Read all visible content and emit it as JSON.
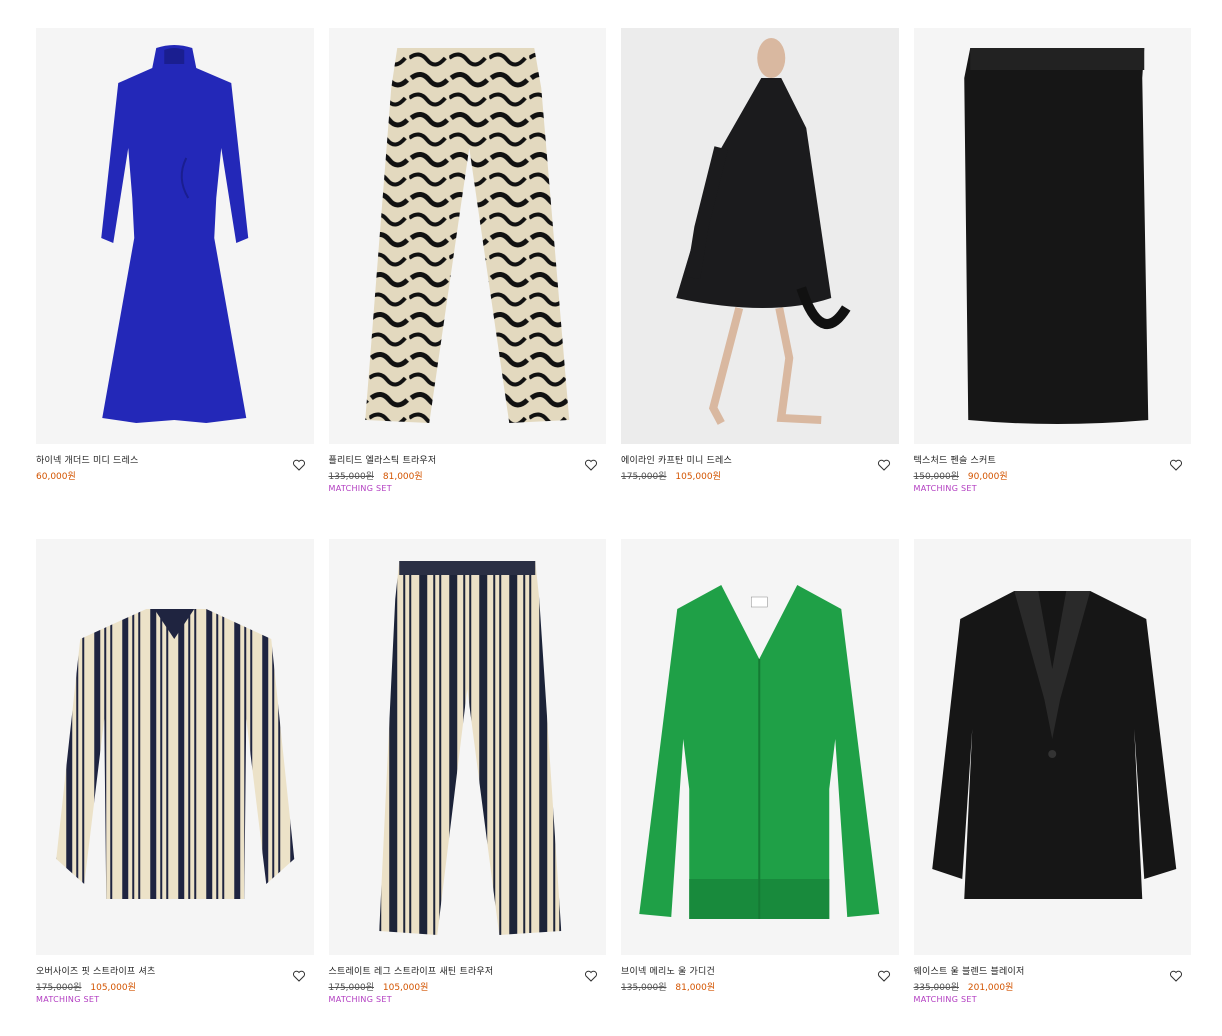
{
  "products": [
    {
      "name": "하이넥 개더드 미디 드레스",
      "old_price": "",
      "price": "60,000원",
      "badge": "",
      "icon": "heart-icon"
    },
    {
      "name": "플리티드 엘라스틱 트라우저",
      "old_price": "135,000원",
      "price": "81,000원",
      "badge": "MATCHING SET",
      "icon": "heart-icon"
    },
    {
      "name": "에이라인 카프탄 미니 드레스",
      "old_price": "175,000원",
      "price": "105,000원",
      "badge": "",
      "icon": "heart-icon"
    },
    {
      "name": "텍스처드 펜슬 스커트",
      "old_price": "150,000원",
      "price": "90,000원",
      "badge": "MATCHING SET",
      "icon": "heart-icon"
    },
    {
      "name": "오버사이즈 핏 스트라이프 셔츠",
      "old_price": "175,000원",
      "price": "105,000원",
      "badge": "MATCHING SET",
      "icon": "heart-icon"
    },
    {
      "name": "스트레이트 레그 스트라이프 새틴 트라우저",
      "old_price": "175,000원",
      "price": "105,000원",
      "badge": "MATCHING SET",
      "icon": "heart-icon"
    },
    {
      "name": "브이넥 메리노 울 가디건",
      "old_price": "135,000원",
      "price": "81,000원",
      "badge": "",
      "icon": "heart-icon"
    },
    {
      "name": "웨이스트 울 블렌드 블레이저",
      "old_price": "335,000원",
      "price": "201,000원",
      "badge": "MATCHING SET",
      "icon": "heart-icon"
    }
  ],
  "colors": {
    "sale": "#d35400",
    "badge": "#b23cc1",
    "image_bg": "#f5f5f5"
  }
}
